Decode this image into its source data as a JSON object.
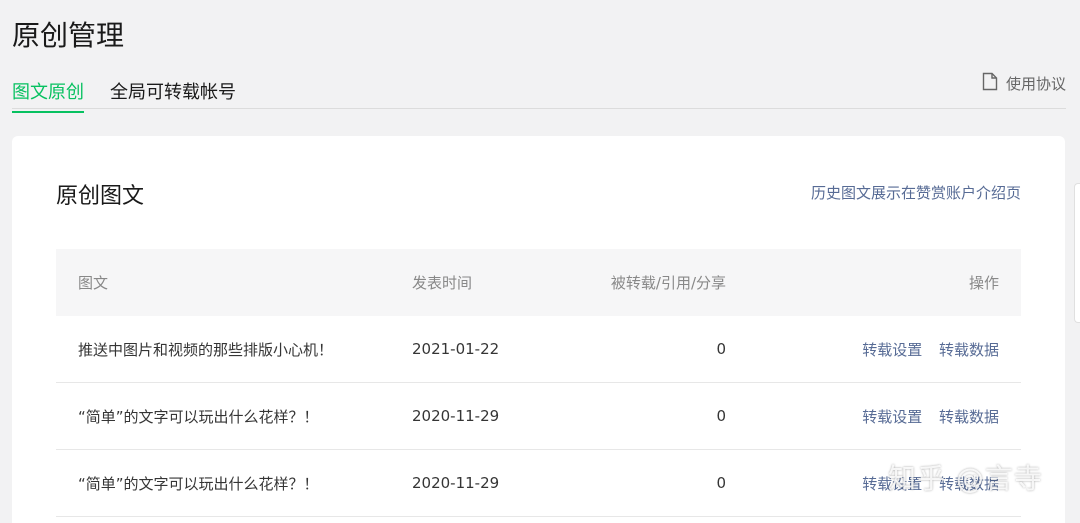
{
  "page": {
    "title": "原创管理"
  },
  "tabs": [
    {
      "label": "图文原创",
      "active": true
    },
    {
      "label": "全局可转载帐号",
      "active": false
    }
  ],
  "agreement": {
    "label": "使用协议",
    "icon": "document-icon"
  },
  "card": {
    "title": "原创图文",
    "link": "历史图文展示在赞赏账户介绍页"
  },
  "table": {
    "headers": {
      "title": "图文",
      "time": "发表时间",
      "count": "被转载/引用/分享",
      "ops": "操作"
    },
    "rows": [
      {
        "title": "推送中图片和视频的那些排版小心机！",
        "time": "2021-01-22",
        "count": "0",
        "op1": "转载设置",
        "op2": "转载数据"
      },
      {
        "title": "“简单”的文字可以玩出什么花样？！",
        "time": "2020-11-29",
        "count": "0",
        "op1": "转载设置",
        "op2": "转载数据"
      },
      {
        "title": "“简单”的文字可以玩出什么花样？！",
        "time": "2020-11-29",
        "count": "0",
        "op1": "转载设置",
        "op2": "转载数据"
      }
    ]
  },
  "watermark": {
    "text": "知乎 @言寺"
  },
  "colors": {
    "accent": "#07c160",
    "link": "#576b95"
  }
}
